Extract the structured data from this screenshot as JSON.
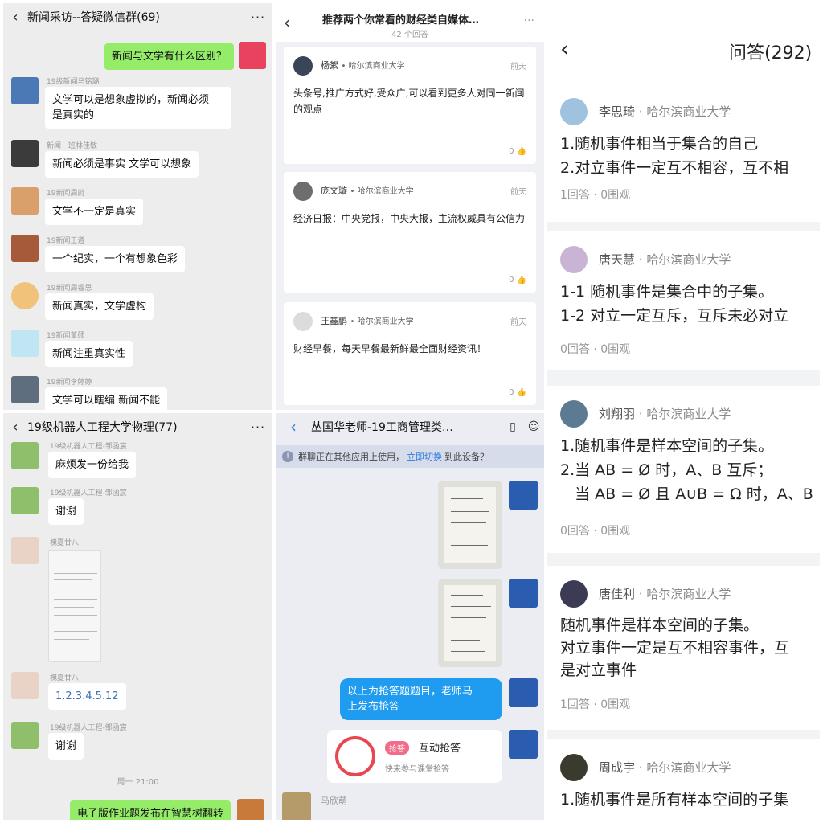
{
  "p1": {
    "title": "新闻采访--答疑微信群(69)",
    "messages": [
      {
        "text": "新闻与文学有什么区别？"
      },
      {
        "sender": "19级新闻马铭璐",
        "text1": "文学可以是想象虚拟的，新闻必须",
        "text2": "是真实的"
      },
      {
        "sender": "新闻一班林佳敏",
        "text": "新闻必须是事实 文学可以想象"
      },
      {
        "sender": "19新闻周蔚",
        "text": "文学不一定是真实"
      },
      {
        "sender": "19新闻王遵",
        "text": "一个纪实，一个有想象色彩"
      },
      {
        "sender": "19新闻周睿思",
        "text": "新闻真实，文学虚构"
      },
      {
        "sender": "19新闻董硕",
        "text": "新闻注重真实性"
      },
      {
        "sender": "19新闻李婷婷",
        "text": "文学可以瞎编 新闻不能"
      }
    ]
  },
  "p2": {
    "title": "推荐两个你常看的财经类自媒体…",
    "answer_count": "42 个回答",
    "answers": [
      {
        "name": "杨絮",
        "school": "• 哈尔滨商业大学",
        "time": "前天",
        "text": "头条号,推广方式好,受众广,可以看到更多人对同一新闻的观点",
        "likes": "0"
      },
      {
        "name": "庞文璇",
        "school": "• 哈尔滨商业大学",
        "time": "前天",
        "text": "经济日报：中央党报，中央大报，主流权威具有公信力",
        "likes": "0"
      },
      {
        "name": "王鑫鹏",
        "school": "• 哈尔滨商业大学",
        "time": "前天",
        "text": "财经早餐，每天早餐最新鲜最全面财经资讯！",
        "likes": "0"
      }
    ]
  },
  "p3": {
    "title": "问答(292)",
    "cards": [
      {
        "name": "李思琦",
        "school": "· 哈尔滨商业大学",
        "lines": [
          "1.随机事件相当于集合的自己",
          "2.对立事件一定互不相容，互不相"
        ],
        "stats": "1回答 · 0围观"
      },
      {
        "name": "唐天慧",
        "school": "· 哈尔滨商业大学",
        "lines": [
          "1-1 随机事件是集合中的子集。",
          "1-2 对立一定互斥，互斥未必对立"
        ],
        "stats": "0回答 · 0围观"
      },
      {
        "name": "刘翔羽",
        "school": "· 哈尔滨商业大学",
        "lines": [
          "1.随机事件是样本空间的子集。",
          "2.当 AB = Ø 时，A、B 互斥；",
          "   当 AB = Ø 且 A∪B = Ω 时，A、B"
        ],
        "stats": "0回答 · 0围观"
      },
      {
        "name": "唐佳利",
        "school": "· 哈尔滨商业大学",
        "lines": [
          "随机事件是样本空间的子集。",
          "对立事件一定是互不相容事件，互",
          "是对立事件"
        ],
        "stats": "1回答 · 0围观"
      },
      {
        "name": "周成宇",
        "school": "· 哈尔滨商业大学",
        "lines": [
          "1.随机事件是所有样本空间的子集"
        ],
        "stats": ""
      }
    ]
  },
  "p4": {
    "title": "19级机器人工程大学物理(77)",
    "messages": [
      {
        "sender": "19级机器人工程-邹函宸",
        "text": "麻烦发一份给我"
      },
      {
        "sender": "19级机器人工程-邹函宸",
        "text": "谢谢"
      },
      {
        "sender": "槐夏廿八",
        "text": ""
      },
      {
        "sender": "槐夏廿八",
        "text": "1.2.3.4.5.12"
      },
      {
        "sender": "19级机器人工程-邹函宸",
        "text": "谢谢"
      },
      {
        "time": "周一 21:00"
      },
      {
        "text": "电子版作业题发布在智慧树翻转"
      }
    ]
  },
  "p5": {
    "title": "丛国华老师-19工商管理类…",
    "notice_pre": "群聊正在其他应用上使用，",
    "notice_link": "立即切换",
    "notice_post": "到此设备？",
    "msg1": "以上为抢答题题目，老师马",
    "msg2": "上发布抢答",
    "card_tag": "抢答",
    "card_title": "互动抢答",
    "card_sub": "快来参与课堂抢答",
    "last_sender": "马欣萌"
  }
}
